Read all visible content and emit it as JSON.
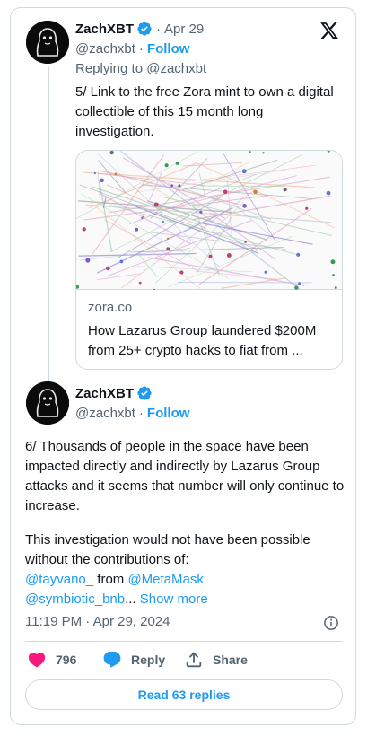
{
  "tweet1": {
    "name": "ZachXBT",
    "date": "Apr 29",
    "handle": "@zachxbt",
    "follow": "Follow",
    "replying_to": "Replying to @zachxbt",
    "text": "5/ Link to the free Zora mint to own a digital collectible of this 15 month long investigation.",
    "link_card": {
      "domain": "zora.co",
      "title": "How Lazarus Group laundered $200M from 25+ crypto hacks to fiat from ..."
    }
  },
  "tweet2": {
    "name": "ZachXBT",
    "handle": "@zachxbt",
    "follow": "Follow",
    "paragraph1": "6/ Thousands of people in the space have been impacted directly and indirectly by Lazarus Group attacks and it seems that number will only continue to increase.",
    "paragraph2": "This investigation would not have been possible without the contributions of:",
    "mention1": "@tayvano_",
    "from_word": "from",
    "mention2": "@MetaMask",
    "mention3": "@symbiotic_bnb",
    "ellipsis": "...",
    "show_more": "Show more",
    "timestamp": "11:19 PM · Apr 29, 2024"
  },
  "actions": {
    "likes": "796",
    "reply": "Reply",
    "share": "Share",
    "read_replies": "Read 63 replies"
  },
  "colors": {
    "accent": "#1d9bf0",
    "like": "#f91880",
    "muted": "#536471",
    "border": "#cfd9de"
  }
}
